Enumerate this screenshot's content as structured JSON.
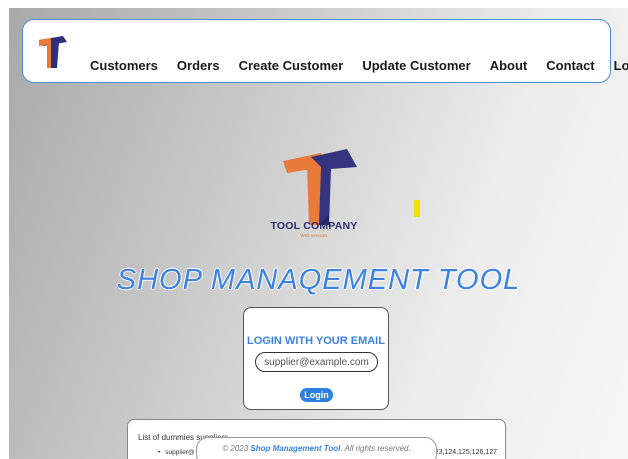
{
  "navbar": {
    "links": [
      "Customers",
      "Orders",
      "Create Customer",
      "Update Customer",
      "About",
      "Contact",
      "Logout"
    ]
  },
  "brand": {
    "name": "TOOL COMPANY",
    "tagline": "Web services",
    "colors": {
      "navy": "#2f2f7a",
      "orange": "#e87a3a"
    }
  },
  "app_title": "SHOP MANAQEMENT TOOL",
  "login": {
    "heading": "LOGIN WITH YOUR EMAIL",
    "email_placeholder": "supplier@example.com",
    "button_label": "Login"
  },
  "dummies": {
    "title": "List of dummies suppliers",
    "item": "supplier@",
    "ids": "23,124,125,126,127"
  },
  "footer": {
    "prefix": "© 2023 ",
    "app_name": "Shop Management Tool",
    "suffix": ". All rights reserved."
  },
  "accent_color": "#3b82e3"
}
